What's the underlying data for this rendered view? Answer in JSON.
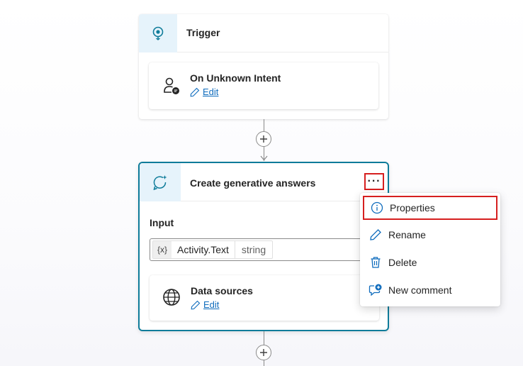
{
  "trigger": {
    "title": "Trigger",
    "icon": "trigger-icon",
    "node": {
      "title": "On Unknown Intent",
      "edit_label": "Edit",
      "icon": "person-chat-icon"
    }
  },
  "generative_node": {
    "title": "Create generative answers",
    "icon": "sparkle-chat-icon",
    "more_label": "···",
    "input": {
      "label": "Input",
      "variable_icon": "{x}",
      "variable_name": "Activity.Text",
      "variable_type": "string"
    },
    "data_sources": {
      "title": "Data sources",
      "edit_label": "Edit",
      "icon": "globe-icon"
    }
  },
  "context_menu": {
    "items": [
      {
        "label": "Properties",
        "icon": "info-icon"
      },
      {
        "label": "Rename",
        "icon": "pencil-icon"
      },
      {
        "label": "Delete",
        "icon": "trash-icon"
      },
      {
        "label": "New comment",
        "icon": "comment-add-icon"
      }
    ]
  },
  "colors": {
    "accent": "#0f6cbd",
    "selected_border": "#0f7c9a",
    "highlight_box": "#d61f1f",
    "icon_bg": "#e6f3fb"
  }
}
